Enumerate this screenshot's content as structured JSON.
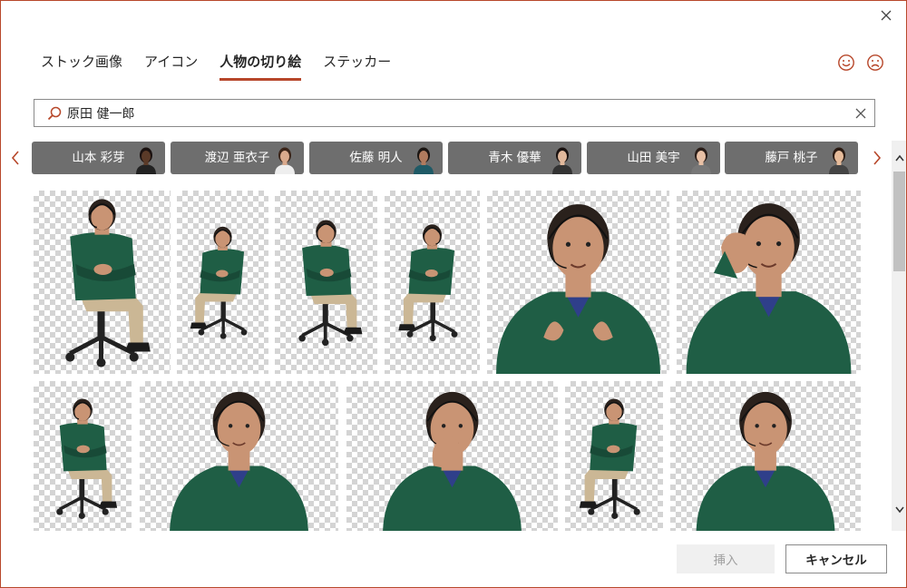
{
  "dialog": {
    "tabs": [
      {
        "label": "ストック画像",
        "active": false
      },
      {
        "label": "アイコン",
        "active": false
      },
      {
        "label": "人物の切り絵",
        "active": true
      },
      {
        "label": "ステッカー",
        "active": false
      }
    ],
    "search": {
      "value": "原田 健一郎"
    },
    "chips": [
      {
        "label": "山本 彩芽",
        "skin": "#5a3a28",
        "hair": "#1a1110",
        "shirt": "#222"
      },
      {
        "label": "渡辺 亜衣子",
        "skin": "#d9a98c",
        "hair": "#3b2418",
        "shirt": "#eee"
      },
      {
        "label": "佐藤 明人",
        "skin": "#b07b5e",
        "hair": "#1b1512",
        "shirt": "#1f5a66"
      },
      {
        "label": "青木 優華",
        "skin": "#e2b99c",
        "hair": "#1a1210",
        "shirt": "#333"
      },
      {
        "label": "山田 美宇",
        "skin": "#e8c0a5",
        "hair": "#2a1d18",
        "shirt": "#777"
      },
      {
        "label": "藤戸 桃子",
        "skin": "#e6bb9a",
        "hair": "#2a1a12",
        "shirt": "#444"
      }
    ],
    "colors": {
      "accent": "#b7472a",
      "chip_bg": "#6e6e6e",
      "shirt": "#1f5e45",
      "pants": "#cbb795",
      "skin": "#c99474",
      "hair": "#2a211c",
      "chair": "#222222"
    },
    "footer": {
      "insert_label": "挿入",
      "cancel_label": "キャンセル"
    },
    "icons": {
      "close": "close-icon",
      "search": "search-icon",
      "clear": "clear-icon",
      "happy": "smile-icon",
      "sad": "frown-icon"
    }
  }
}
